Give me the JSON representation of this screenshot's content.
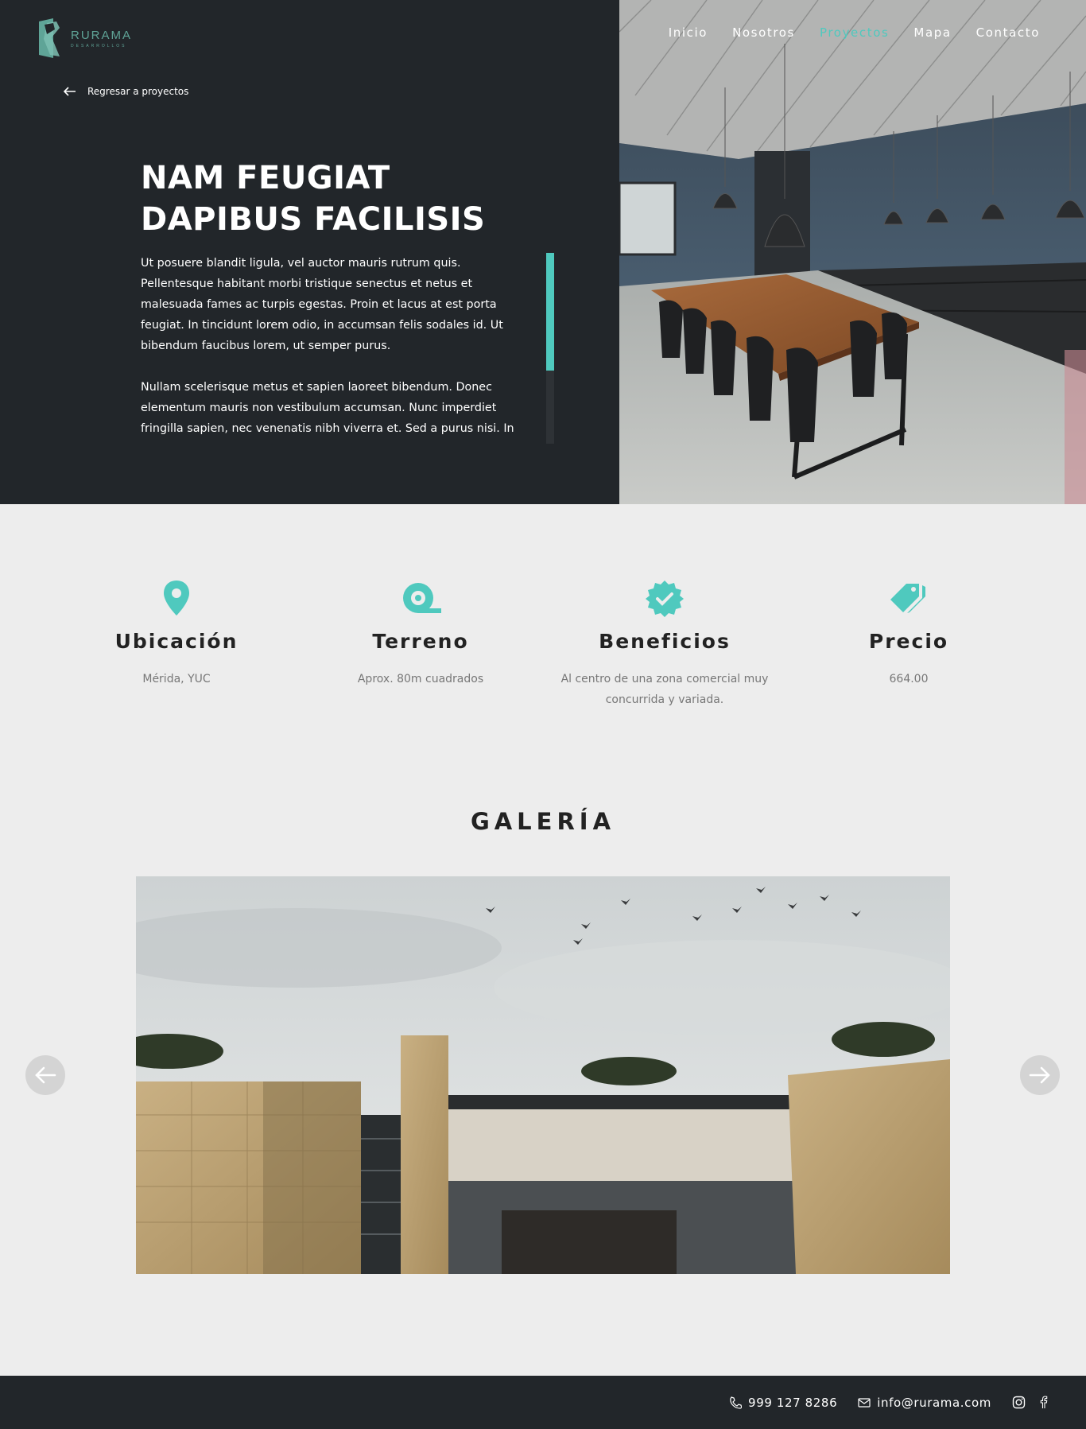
{
  "brand": {
    "name": "RURAMA",
    "tagline": "DESARROLLOS",
    "color": "#5fa497"
  },
  "accent": "#4fc9be",
  "nav": {
    "items": [
      {
        "label": "Inicio",
        "active": false
      },
      {
        "label": "Nosotros",
        "active": false
      },
      {
        "label": "Proyectos",
        "active": true
      },
      {
        "label": "Mapa",
        "active": false
      },
      {
        "label": "Contacto",
        "active": false
      }
    ]
  },
  "back_link": {
    "label": "Regresar a proyectos",
    "icon": "arrow-left-icon"
  },
  "project": {
    "title": "NAM FEUGIAT DAPIBUS FACILISIS",
    "paragraphs": [
      "Ut posuere blandit ligula, vel auctor mauris rutrum quis. Pellentesque habitant morbi tristique senectus et netus et malesuada fames ac turpis egestas. Proin et lacus at est porta feugiat. In tincidunt lorem odio, in accumsan felis sodales id. Ut bibendum faucibus lorem, ut semper purus.",
      "Nullam scelerisque metus et sapien laoreet bibendum. Donec elementum mauris non vestibulum accumsan. Nunc imperdiet fringilla sapien, nec venenatis nibh viverra et. Sed a purus nisi. In"
    ],
    "hero_image": "kitchen-dining-photo"
  },
  "features": [
    {
      "icon": "location-pin-icon",
      "title": "Ubicación",
      "value": "Mérida, YUC"
    },
    {
      "icon": "tape-measure-icon",
      "title": "Terreno",
      "value": "Aprox. 80m cuadrados"
    },
    {
      "icon": "verified-badge-icon",
      "title": "Beneficios",
      "value": "Al centro de una zona comercial muy concurrida y variada."
    },
    {
      "icon": "price-tag-icon",
      "title": "Precio",
      "value": "664.00"
    }
  ],
  "gallery": {
    "title": "GALERÍA",
    "image": "house-exterior-photo",
    "prev_icon": "arrow-left-icon",
    "next_icon": "arrow-right-icon"
  },
  "footer": {
    "phone": "999 127 8286",
    "email": "info@rurama.com",
    "social": [
      "instagram-icon",
      "facebook-icon"
    ]
  }
}
